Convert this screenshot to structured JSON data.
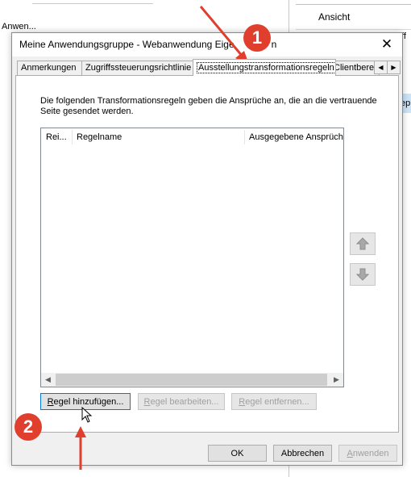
{
  "background": {
    "left_text": "Anwen...",
    "right_item": "Ansicht",
    "right_edge_text": "ff",
    "right_edge_text2": "ep"
  },
  "dialog": {
    "title": "Meine Anwendungsgruppe - Webanwendung Eige",
    "title_tail": "n",
    "close_glyph": "✕"
  },
  "tabs": [
    {
      "label": "Anmerkungen"
    },
    {
      "label": "Zugriffssteuerungsrichtlinie"
    },
    {
      "label": "Ausstellungstransformationsregeln"
    },
    {
      "label": "Clientbere"
    }
  ],
  "panel": {
    "description": "Die folgenden Transformationsregeln geben die Ansprüche an, die an die vertrauende Seite gesendet werden.",
    "columns": [
      "Rei...",
      "Regelname",
      "Ausgegebene Ansprüch"
    ]
  },
  "buttons": {
    "add_rule": {
      "prefix": "R",
      "rest": "egel hinzufügen..."
    },
    "edit_rule": {
      "prefix": "R",
      "rest": "egel bearbeiten..."
    },
    "remove_rule": {
      "prefix": "R",
      "rest": "egel entfernen..."
    },
    "ok": "OK",
    "cancel": "Abbrechen",
    "apply": {
      "prefix": "A",
      "rest": "nwenden"
    }
  },
  "annotations": {
    "badge1": "1",
    "badge2": "2",
    "accent": "#e03f2e"
  }
}
